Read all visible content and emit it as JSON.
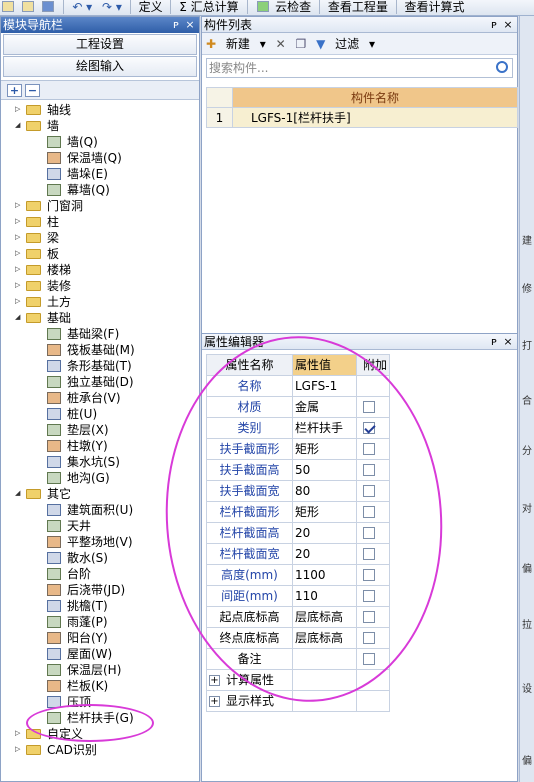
{
  "toolbar": {
    "items": [
      "定义",
      "Σ 汇总计算",
      "云检查",
      "查看工程量",
      "查看计算式"
    ]
  },
  "nav": {
    "title": "模块导航栏",
    "pin": "ᴘ",
    "close": "×",
    "btn_project": "工程设置",
    "btn_draw": "绘图输入",
    "add": "+",
    "remove": "−",
    "tree": [
      {
        "label": "轴线",
        "level": 0,
        "exp": "▷"
      },
      {
        "label": "墙",
        "level": 0,
        "exp": "◢"
      },
      {
        "label": "墙(Q)",
        "level": 1
      },
      {
        "label": "保温墙(Q)",
        "level": 1
      },
      {
        "label": "墙垛(E)",
        "level": 1
      },
      {
        "label": "幕墙(Q)",
        "level": 1
      },
      {
        "label": "门窗洞",
        "level": 0,
        "exp": "▷"
      },
      {
        "label": "柱",
        "level": 0,
        "exp": "▷"
      },
      {
        "label": "梁",
        "level": 0,
        "exp": "▷"
      },
      {
        "label": "板",
        "level": 0,
        "exp": "▷"
      },
      {
        "label": "楼梯",
        "level": 0,
        "exp": "▷"
      },
      {
        "label": "装修",
        "level": 0,
        "exp": "▷"
      },
      {
        "label": "土方",
        "level": 0,
        "exp": "▷"
      },
      {
        "label": "基础",
        "level": 0,
        "exp": "◢"
      },
      {
        "label": "基础梁(F)",
        "level": 1
      },
      {
        "label": "筏板基础(M)",
        "level": 1
      },
      {
        "label": "条形基础(T)",
        "level": 1
      },
      {
        "label": "独立基础(D)",
        "level": 1
      },
      {
        "label": "桩承台(V)",
        "level": 1
      },
      {
        "label": "桩(U)",
        "level": 1
      },
      {
        "label": "垫层(X)",
        "level": 1
      },
      {
        "label": "柱墩(Y)",
        "level": 1
      },
      {
        "label": "集水坑(S)",
        "level": 1
      },
      {
        "label": "地沟(G)",
        "level": 1
      },
      {
        "label": "其它",
        "level": 0,
        "exp": "◢"
      },
      {
        "label": "建筑面积(U)",
        "level": 1
      },
      {
        "label": "天井",
        "level": 1
      },
      {
        "label": "平整场地(V)",
        "level": 1
      },
      {
        "label": "散水(S)",
        "level": 1
      },
      {
        "label": "台阶",
        "level": 1
      },
      {
        "label": "后浇带(JD)",
        "level": 1
      },
      {
        "label": "挑檐(T)",
        "level": 1
      },
      {
        "label": "雨蓬(P)",
        "level": 1
      },
      {
        "label": "阳台(Y)",
        "level": 1
      },
      {
        "label": "屋面(W)",
        "level": 1
      },
      {
        "label": "保温层(H)",
        "level": 1
      },
      {
        "label": "栏板(K)",
        "level": 1
      },
      {
        "label": "压顶",
        "level": 1
      },
      {
        "label": "栏杆扶手(G)",
        "level": 1
      },
      {
        "label": "自定义",
        "level": 0,
        "exp": "▷"
      },
      {
        "label": "CAD识别",
        "level": 0,
        "exp": "▷"
      }
    ]
  },
  "components": {
    "title": "构件列表",
    "pin": "ᴘ",
    "close": "×",
    "new_label": "新建",
    "filter_label": "过滤",
    "search_placeholder": "搜索构件...",
    "col_name": "构件名称",
    "rows": [
      {
        "num": "1",
        "name": "LGFS-1[栏杆扶手]"
      }
    ]
  },
  "properties": {
    "title": "属性编辑器",
    "pin": "ᴘ",
    "close": "×",
    "headers": {
      "name": "属性名称",
      "value": "属性值",
      "extra": "附加"
    },
    "rows": [
      {
        "name": "名称",
        "value": "LGFS-1",
        "check": "none"
      },
      {
        "name": "材质",
        "value": "金属",
        "check": "off"
      },
      {
        "name": "类别",
        "value": "栏杆扶手",
        "check": "on"
      },
      {
        "name": "扶手截面形",
        "value": "矩形",
        "check": "off"
      },
      {
        "name": "扶手截面高",
        "value": "50",
        "check": "off"
      },
      {
        "name": "扶手截面宽",
        "value": "80",
        "check": "off"
      },
      {
        "name": "栏杆截面形",
        "value": "矩形",
        "check": "off"
      },
      {
        "name": "栏杆截面高",
        "value": "20",
        "check": "off"
      },
      {
        "name": "栏杆截面宽",
        "value": "20",
        "check": "off"
      },
      {
        "name": "高度(mm)",
        "value": "1100",
        "check": "off"
      },
      {
        "name": "间距(mm)",
        "value": "110",
        "check": "off"
      },
      {
        "name": "起点底标高",
        "value": "层底标高",
        "check": "off"
      },
      {
        "name": "终点底标高",
        "value": "层底标高",
        "check": "off"
      },
      {
        "name": "备注",
        "value": "",
        "check": "off"
      }
    ],
    "groups": [
      "计算属性",
      "显示样式"
    ]
  },
  "side_labels": [
    "建",
    "修",
    "打",
    "合",
    "分",
    "对",
    "偏",
    "拉",
    "设",
    "偏"
  ],
  "colors": {
    "title_bar": "#2f5ea8",
    "highlight": "#d83ad8",
    "header": "#f0c68a"
  }
}
